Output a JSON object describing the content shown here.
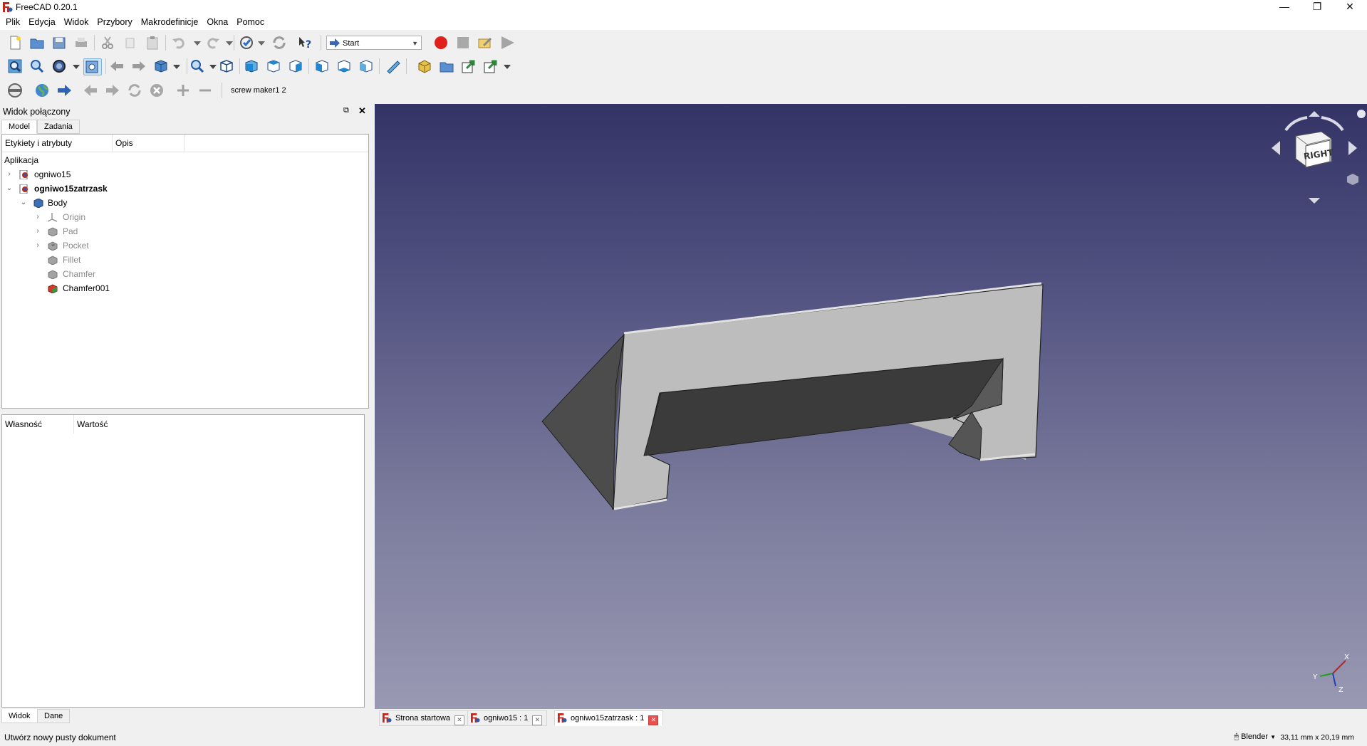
{
  "app": {
    "title": "FreeCAD 0.20.1"
  },
  "window_controls": {
    "minimize": "—",
    "maximize": "❐",
    "close": "✕"
  },
  "menu": [
    "Plik",
    "Edycja",
    "Widok",
    "Przybory",
    "Makrodefinicje",
    "Okna",
    "Pomoc"
  ],
  "toolbar": {
    "workbench": "Start",
    "macro_label": "screw maker1 2"
  },
  "combo_view": {
    "title": "Widok połączony",
    "tabs": [
      "Model",
      "Zadania"
    ],
    "tree_headers": [
      "Etykiety i atrybuty",
      "Opis"
    ],
    "tree": [
      {
        "label": "Aplikacja"
      },
      {
        "label": "ogniwo15"
      },
      {
        "label": "ogniwo15zatrzask"
      },
      {
        "label": "Body"
      },
      {
        "label": "Origin"
      },
      {
        "label": "Pad"
      },
      {
        "label": "Pocket"
      },
      {
        "label": "Fillet"
      },
      {
        "label": "Chamfer"
      },
      {
        "label": "Chamfer001"
      }
    ],
    "property_headers": [
      "Własność",
      "Wartość"
    ],
    "bottom_tabs": [
      "Widok",
      "Dane"
    ]
  },
  "navcube": {
    "face": "RIGHT",
    "axes": [
      "X",
      "Y",
      "Z"
    ]
  },
  "doc_tabs": [
    "Strona startowa",
    "ogniwo15 : 1",
    "ogniwo15zatrzask : 1"
  ],
  "status": {
    "message": "Utwórz nowy pusty dokument",
    "nav_style": "Blender",
    "dimensions": "33,11 mm x 20,19 mm"
  },
  "colors": {
    "viewport_top": "#333366",
    "viewport_bottom": "#9999b3",
    "model_face_light": "#b8b8b8",
    "model_face_dark": "#4a4a4a",
    "record_red": "#e0201c"
  }
}
